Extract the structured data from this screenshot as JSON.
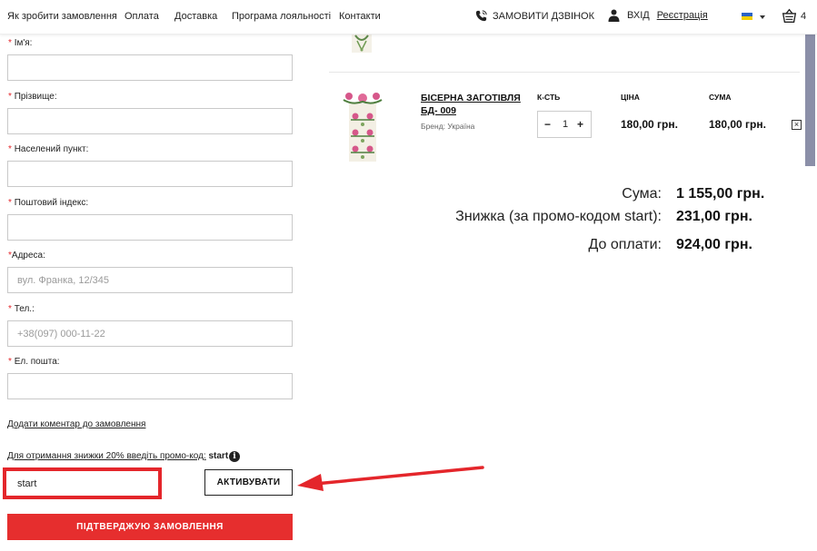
{
  "header": {
    "nav": [
      "Як зробити замовлення",
      "Оплата",
      "Доставка",
      "Програма лояльності",
      "Контакти"
    ],
    "callback_label": "ЗАМОВИТИ ДЗВІНОК",
    "login_label": "ВХІД",
    "register_label": "Реєстрація",
    "cart_count": "4",
    "icons": {
      "callback": "phone-icon",
      "login": "user-icon",
      "cart": "basket-icon"
    },
    "colors": {
      "flag_blue": "#2b63c6",
      "flag_yellow": "#f5d000"
    }
  },
  "form": {
    "fields": [
      {
        "label": "Ім'я:",
        "value": "",
        "placeholder": ""
      },
      {
        "label": "Прізвище:",
        "value": "",
        "placeholder": ""
      },
      {
        "label": "Населений пункт:",
        "value": "",
        "placeholder": ""
      },
      {
        "label": "Поштовий індекс:",
        "value": "",
        "placeholder": ""
      },
      {
        "label": "Адреса:",
        "value": "",
        "placeholder": "вул. Франка, 12/345"
      },
      {
        "label": "Тел.:",
        "value": "",
        "placeholder": "+38(097) 000-11-22"
      },
      {
        "label": "Ел. пошта:",
        "value": "",
        "placeholder": ""
      }
    ],
    "required_mark": "*",
    "add_comment_link": "Додати коментар до замовлення",
    "promo_note": "Для отримання знижки 20% введіть промо-код:",
    "promo_code_hint": "start",
    "promo_value": "start",
    "activate_label": "АКТИВУВАТИ",
    "submit_label": "ПІДТВЕРДЖУЮ ЗАМОВЛЕННЯ",
    "accent_color": "#e62e2e"
  },
  "cart": {
    "item": {
      "title": "БІСЕРНА ЗАГОТІВЛЯ БД- 009",
      "brand": "Бренд: Україна",
      "qty_header": "К-СТЬ",
      "price_header": "ЦІНА",
      "sum_header": "СУМА",
      "qty": "1",
      "price": "180,00 грн.",
      "sum": "180,00 грн.",
      "minus": "−",
      "plus": "+",
      "remove": "×"
    },
    "totals": {
      "sum_label": "Сума:",
      "sum_value": "1 155,00 грн.",
      "discount_label": "Знижка (за промо-кодом start):",
      "discount_value": "231,00 грн.",
      "pay_label": "До оплати:",
      "pay_value": "924,00 грн."
    }
  }
}
